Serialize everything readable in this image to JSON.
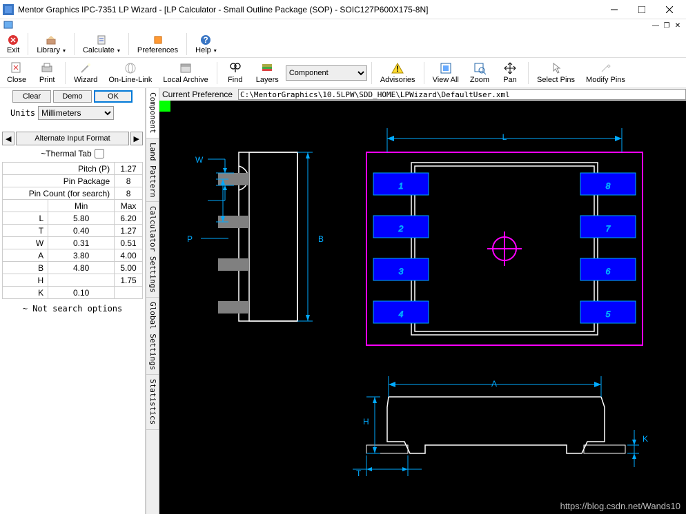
{
  "window": {
    "title": "Mentor Graphics IPC-7351 LP Wizard  - [LP Calculator - Small Outline Package (SOP) - SOIC127P600X175-8N]"
  },
  "menubar": {
    "exit": "Exit",
    "library": "Library",
    "calculate": "Calculate",
    "preferences": "Preferences",
    "help": "Help"
  },
  "toolbar": {
    "close": "Close",
    "print": "Print",
    "wizard": "Wizard",
    "online": "On-Line-Link",
    "archive": "Local Archive",
    "find": "Find",
    "layers": "Layers",
    "compselect": "Component",
    "advisories": "Advisories",
    "viewall": "View All",
    "zoom": "Zoom",
    "pan": "Pan",
    "selectpins": "Select Pins",
    "modifypins": "Modify Pins"
  },
  "leftpanel": {
    "clear": "Clear",
    "demo": "Demo",
    "ok": "OK",
    "units_label": "Units",
    "units_value": "Millimeters",
    "alt_left": "◀",
    "alt_format": "Alternate Input Format",
    "alt_right": "▶",
    "thermal": "~Thermal Tab",
    "rows": {
      "pitch": {
        "label": "Pitch (P)",
        "val": "1.27"
      },
      "pinpkg": {
        "label": "Pin Package",
        "val": "8"
      },
      "pincount": {
        "label": "Pin Count (for search)",
        "val": "8"
      }
    },
    "hdr_min": "Min",
    "hdr_max": "Max",
    "dims": {
      "L": {
        "min": "5.80",
        "max": "6.20"
      },
      "T": {
        "min": "0.40",
        "max": "1.27"
      },
      "W": {
        "min": "0.31",
        "max": "0.51"
      },
      "A": {
        "min": "3.80",
        "max": "4.00"
      },
      "B": {
        "min": "4.80",
        "max": "5.00"
      },
      "H": {
        "min": "",
        "max": "1.75"
      },
      "K": {
        "min": "0.10",
        "max": ""
      }
    },
    "note": "~ Not search options"
  },
  "tabs": {
    "component": "Component",
    "landpattern": "Land Pattern",
    "calcsettings": "Calculator Settings",
    "globalsettings": "Global Settings",
    "statistics": "Statistics"
  },
  "prefbar": {
    "label": "Current Preference",
    "path": "C:\\MentorGraphics\\10.5LPW\\SDD_HOME\\LPWizard\\DefaultUser.xml"
  },
  "drawing": {
    "dim_L": "L",
    "dim_W": "W",
    "dim_P": "P",
    "dim_B": "B",
    "dim_A": "A",
    "dim_H": "H",
    "dim_T": "T",
    "dim_K": "K",
    "pins": [
      "1",
      "2",
      "3",
      "4",
      "5",
      "6",
      "7",
      "8"
    ]
  },
  "watermark": "https://blog.csdn.net/Wands10"
}
